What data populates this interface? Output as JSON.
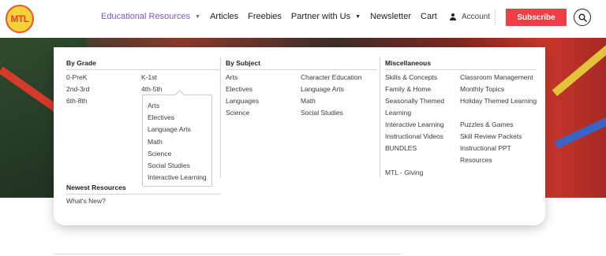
{
  "logo": {
    "text": "MTL"
  },
  "nav": {
    "items": [
      {
        "label": "Educational Resources",
        "has_caret": true,
        "active": true
      },
      {
        "label": "Articles"
      },
      {
        "label": "Freebies"
      },
      {
        "label": "Partner with Us",
        "has_caret": true
      },
      {
        "label": "Newsletter"
      },
      {
        "label": "Cart"
      }
    ],
    "caret": "▼"
  },
  "account": {
    "label": "Account",
    "icon": "person-icon"
  },
  "subscribe": {
    "label": "Subscribe",
    "color": "#ef3e46"
  },
  "search": {
    "icon": "search-icon"
  },
  "menu": {
    "by_grade": {
      "heading": "By Grade",
      "left": [
        "0-PreK",
        "2nd-3rd",
        "6th-8th"
      ],
      "right": [
        "K-1st",
        "4th-5th"
      ]
    },
    "grade_submenu": [
      "Arts",
      "Electives",
      "Language Arts",
      "Math",
      "Science",
      "Social Studies",
      "Interactive Learning"
    ],
    "newest": {
      "heading": "Newest Resources",
      "items": [
        "What's New?"
      ]
    },
    "by_subject": {
      "heading": "By Subject",
      "left": [
        "Arts",
        "Electives",
        "Languages",
        "Science"
      ],
      "right": [
        "Character Education",
        "Language Arts",
        "Math",
        "Social Studies"
      ]
    },
    "misc": {
      "heading": "Miscellaneous",
      "left": [
        "Skills & Concepts",
        "Family & Home",
        "Seasonally Themed",
        "Learning",
        "Interactive Learning",
        "Instructional Videos",
        "BUNDLES",
        "MTL - Giving"
      ],
      "right": [
        "Classroom Management",
        "Monthly Topics",
        "Holiday Themed Learning",
        "Puzzles & Games",
        "Skill Review Packets",
        "Instructional PPT",
        "Resources"
      ]
    }
  },
  "colors": {
    "accent": "#7b57d6",
    "subscribe": "#ef3e46"
  }
}
